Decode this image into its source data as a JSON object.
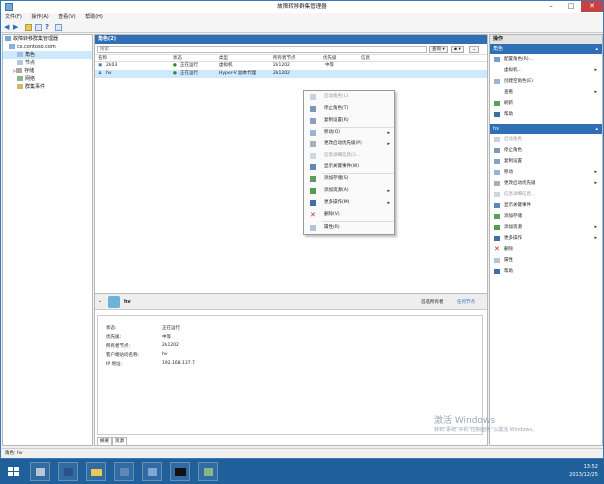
{
  "window": {
    "title": "故障转移群集管理器"
  },
  "menu": [
    "文件(F)",
    "操作(A)",
    "查看(V)",
    "帮助(H)"
  ],
  "tree": {
    "root": "故障转移群集管理器",
    "cluster": "cs.contoso.com",
    "items": [
      "角色",
      "节点",
      "存储",
      "网络",
      "群集事件"
    ]
  },
  "center": {
    "title": "角色(2)",
    "search_placeholder": "搜索",
    "query_label": "查询",
    "columns": [
      "名称",
      "状态",
      "类型",
      "所有者节点",
      "优先级",
      "信息"
    ],
    "rows": [
      {
        "name": "2k03",
        "status": "正在运行",
        "type": "虚拟机",
        "owner": "2k1202",
        "priority": "中等",
        "info": ""
      },
      {
        "name": "hv",
        "status": "正在运行",
        "type": "Hyper-V 副本代理",
        "owner": "2k1202",
        "priority": "中等",
        "info": ""
      }
    ]
  },
  "context_menu": [
    {
      "label": "启动角色(L)",
      "disabled": true,
      "arrow": false
    },
    {
      "label": "停止角色(T)",
      "disabled": false,
      "arrow": false
    },
    {
      "label": "复制设置(R)",
      "disabled": false,
      "arrow": false
    },
    {
      "label": "移动(O)",
      "disabled": false,
      "arrow": true
    },
    {
      "label": "更改启动优先级(P)",
      "disabled": false,
      "arrow": true
    },
    {
      "label": "信息详细信息(I)...",
      "disabled": true,
      "arrow": false
    },
    {
      "label": "显示关键事件(W)",
      "disabled": false,
      "arrow": false
    },
    {
      "label": "添加存储(S)",
      "disabled": false,
      "arrow": false
    },
    {
      "label": "添加资源(A)",
      "disabled": false,
      "arrow": true
    },
    {
      "label": "更多操作(M)",
      "disabled": false,
      "arrow": true
    },
    {
      "label": "删除(V)",
      "disabled": false,
      "arrow": false
    },
    {
      "label": "属性(R)",
      "disabled": false,
      "arrow": false
    }
  ],
  "detail": {
    "name": "hv",
    "preferred_owners_label": "首选所有者",
    "any_node_link": "任何节点",
    "fields": [
      {
        "label": "状态:",
        "value": "正在运行"
      },
      {
        "label": "优先级:",
        "value": "中等"
      },
      {
        "label": "所有者节点:",
        "value": "2k1202"
      },
      {
        "label": "客户端访问名称:",
        "value": "hv"
      },
      {
        "label": "IP 地址:",
        "value": "192.168.137.7"
      }
    ],
    "tabs": [
      "摘要",
      "资源"
    ]
  },
  "actions": {
    "header": "操作",
    "section1": "角色",
    "section1_items": [
      {
        "label": "配置角色(R)...",
        "disabled": false,
        "arrow": false
      },
      {
        "label": "虚拟机...",
        "disabled": false,
        "arrow": true
      },
      {
        "label": "创建空角色(E)",
        "disabled": false,
        "arrow": false
      },
      {
        "label": "查看",
        "disabled": false,
        "arrow": true
      },
      {
        "label": "刷新",
        "disabled": false,
        "arrow": false
      },
      {
        "label": "帮助",
        "disabled": false,
        "arrow": false
      }
    ],
    "section2": "hv",
    "section2_items": [
      {
        "label": "启动角色",
        "disabled": true,
        "arrow": false
      },
      {
        "label": "停止角色",
        "disabled": false,
        "arrow": false
      },
      {
        "label": "复制设置",
        "disabled": false,
        "arrow": false
      },
      {
        "label": "移动",
        "disabled": false,
        "arrow": true
      },
      {
        "label": "更改启动优先级",
        "disabled": false,
        "arrow": true
      },
      {
        "label": "信息详细信息...",
        "disabled": true,
        "arrow": false
      },
      {
        "label": "显示关键事件",
        "disabled": false,
        "arrow": false
      },
      {
        "label": "添加存储",
        "disabled": false,
        "arrow": false
      },
      {
        "label": "添加资源",
        "disabled": false,
        "arrow": true
      },
      {
        "label": "更多操作",
        "disabled": false,
        "arrow": true
      },
      {
        "label": "删除",
        "disabled": false,
        "arrow": false
      },
      {
        "label": "属性",
        "disabled": false,
        "arrow": false
      },
      {
        "label": "帮助",
        "disabled": false,
        "arrow": false
      }
    ]
  },
  "statusbar": "角色: hv",
  "watermark": {
    "line1": "激活 Windows",
    "line2": "转到\"系统\"中的\"控制面板\"以激活 Windows。"
  },
  "clock": {
    "time": "13:52",
    "date": "2013/12/25"
  },
  "colors": {
    "accent": "#2f6fb5",
    "taskbar": "#1f5f9a",
    "close": "#c74343"
  }
}
